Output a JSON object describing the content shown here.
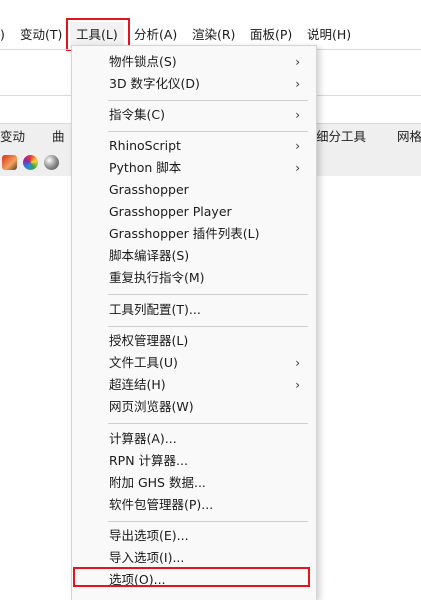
{
  "menubar": {
    "items": [
      {
        "label": ")"
      },
      {
        "label": "变动(T)"
      },
      {
        "label": "工具(L)"
      },
      {
        "label": "分析(A)"
      },
      {
        "label": "渲染(R)"
      },
      {
        "label": "面板(P)"
      },
      {
        "label": "说明(H)"
      }
    ]
  },
  "tabs": {
    "items": [
      {
        "label": "变动"
      },
      {
        "label": "曲"
      },
      {
        "label": "细分工具"
      },
      {
        "label": "网格"
      }
    ]
  },
  "toolbar_icons": [
    "render-icon",
    "color-wheel-icon",
    "sphere-icon"
  ],
  "menu": {
    "groups": [
      [
        {
          "label": "物件锁点(S)",
          "submenu": true
        },
        {
          "label": "3D 数字化仪(D)",
          "submenu": true
        }
      ],
      [
        {
          "label": "指令集(C)",
          "submenu": true
        }
      ],
      [
        {
          "label": "RhinoScript",
          "submenu": true
        },
        {
          "label": "Python 脚本",
          "submenu": true
        },
        {
          "label": "Grasshopper",
          "submenu": false
        },
        {
          "label": "Grasshopper Player",
          "submenu": false
        },
        {
          "label": "Grasshopper 插件列表(L)",
          "submenu": false
        },
        {
          "label": "脚本编译器(S)",
          "submenu": false
        },
        {
          "label": "重复执行指令(M)",
          "submenu": false
        }
      ],
      [
        {
          "label": "工具列配置(T)...",
          "submenu": false
        }
      ],
      [
        {
          "label": "授权管理器(L)",
          "submenu": false
        },
        {
          "label": "文件工具(U)",
          "submenu": true
        },
        {
          "label": "超连结(H)",
          "submenu": true
        },
        {
          "label": "网页浏览器(W)",
          "submenu": false
        }
      ],
      [
        {
          "label": "计算器(A)...",
          "submenu": false
        },
        {
          "label": "RPN 计算器...",
          "submenu": false
        },
        {
          "label": "附加 GHS 数据...",
          "submenu": false
        },
        {
          "label": "软件包管理器(P)...",
          "submenu": false
        }
      ],
      [
        {
          "label": "导出选项(E)...",
          "submenu": false
        },
        {
          "label": "导入选项(I)...",
          "submenu": false
        },
        {
          "label": "选项(O)...",
          "submenu": false
        }
      ]
    ]
  },
  "colors": {
    "highlight": "#e5131d",
    "menu_bg": "#f9f9f9",
    "separator": "#cfcfcf"
  }
}
